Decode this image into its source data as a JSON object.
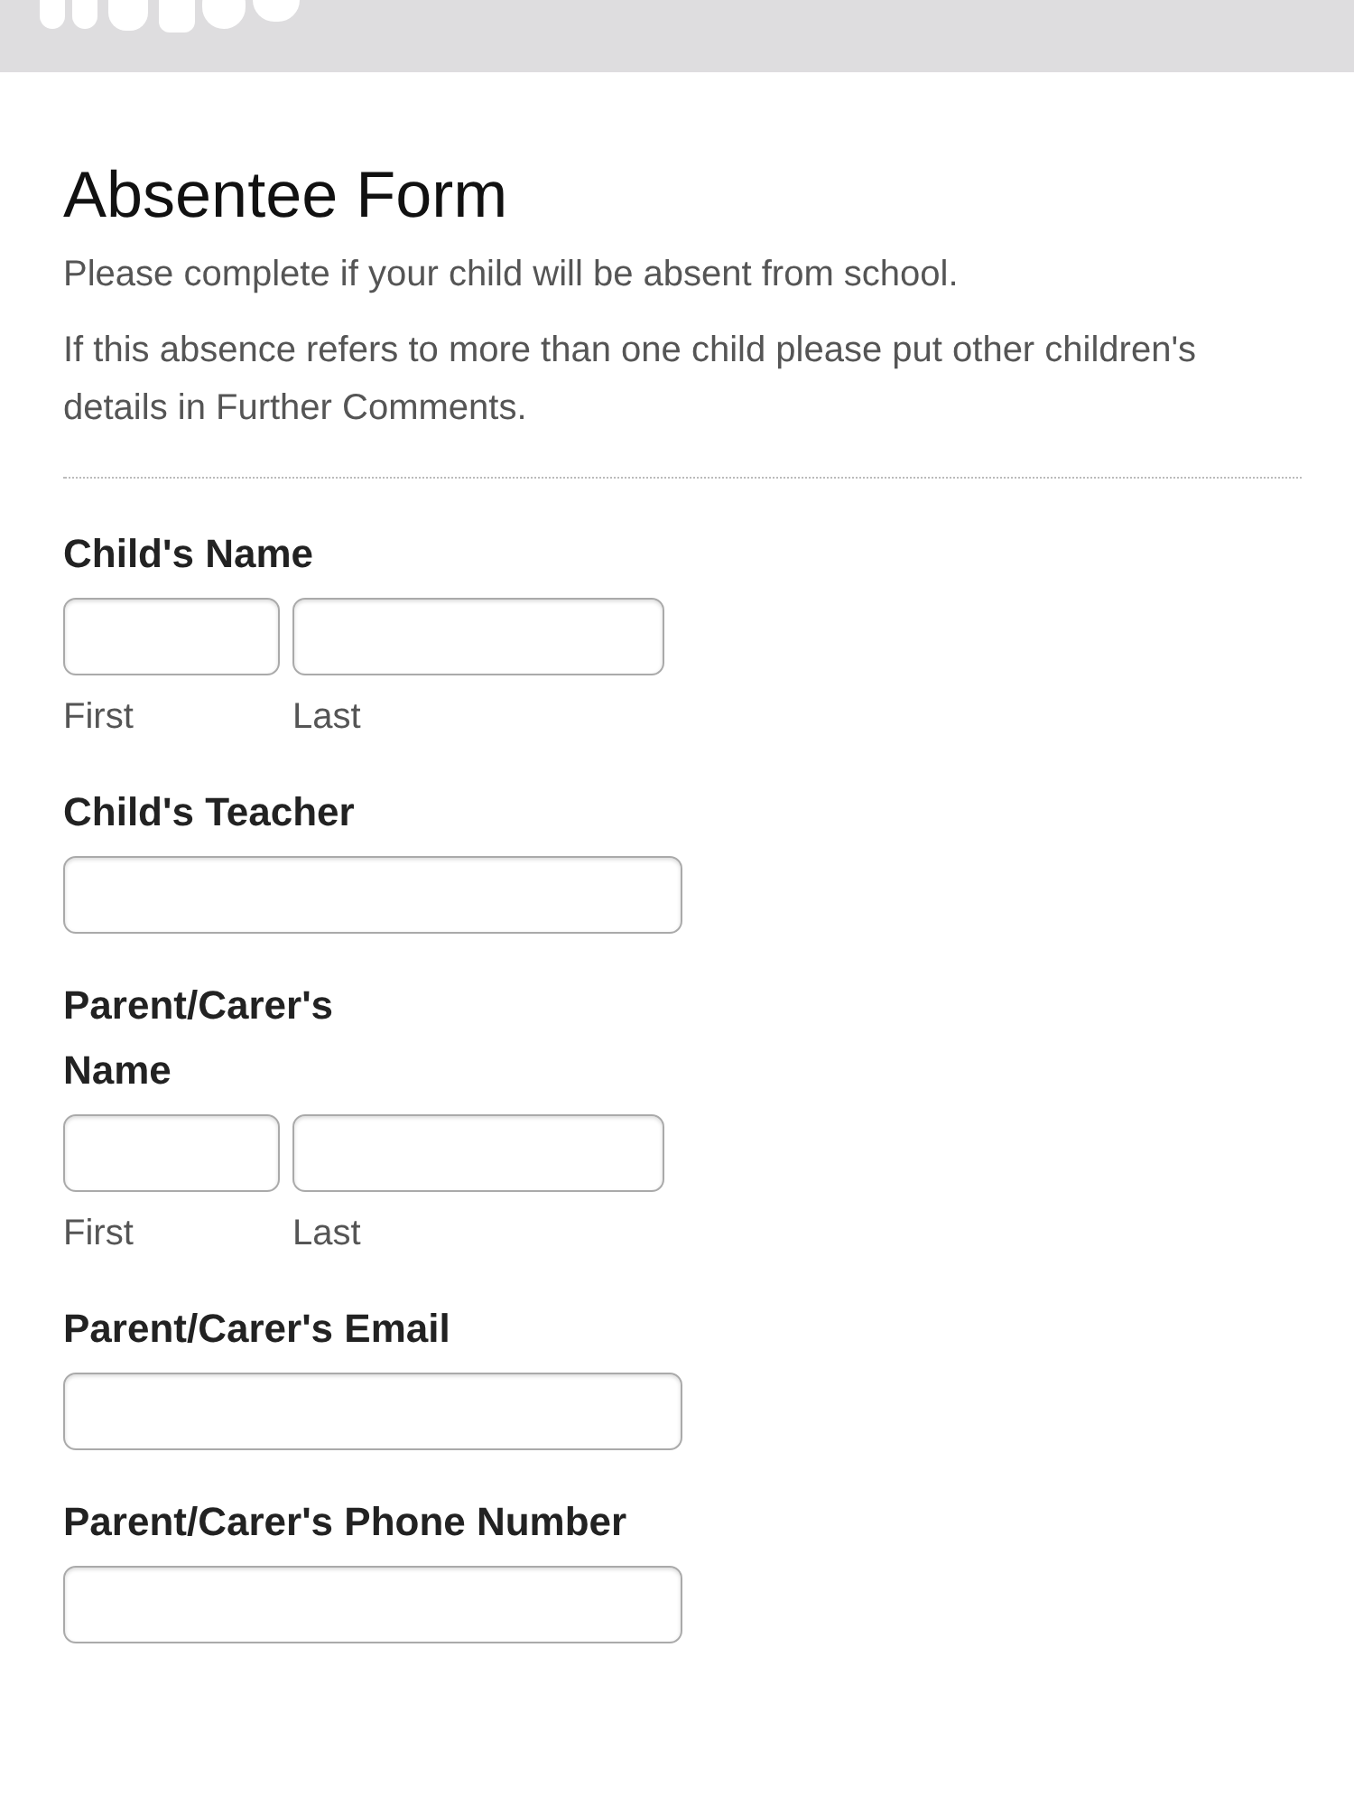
{
  "title": "Absentee Form",
  "description": [
    "Please complete if your child will be absent from school.",
    "If this absence refers to more than one child please put other children's details in Further Comments."
  ],
  "fields": [
    {
      "kind": "name",
      "label": "Child's Name",
      "sublabels": [
        "First",
        "Last"
      ]
    },
    {
      "kind": "single",
      "label": "Child's Teacher"
    },
    {
      "kind": "name",
      "label": "Parent/Carer's Name",
      "sublabels": [
        "First",
        "Last"
      ]
    },
    {
      "kind": "single",
      "label": "Parent/Carer's Email"
    },
    {
      "kind": "single",
      "label": "Parent/Carer's Phone Number"
    }
  ]
}
